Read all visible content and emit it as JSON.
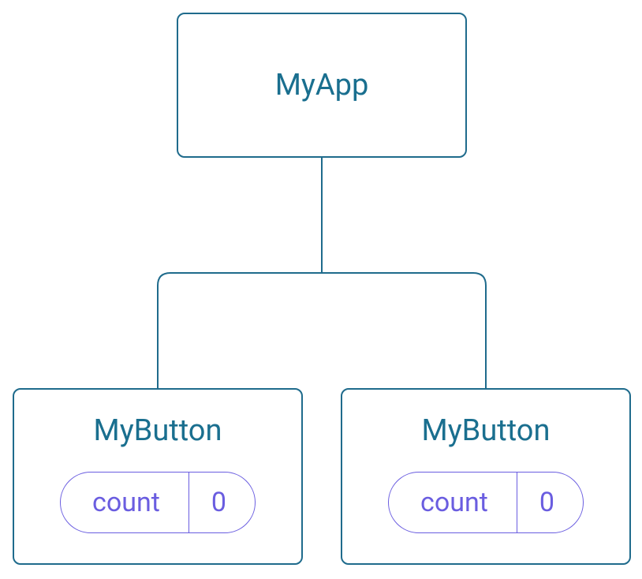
{
  "root": {
    "title": "MyApp"
  },
  "children": [
    {
      "title": "MyButton",
      "state": {
        "label": "count",
        "value": "0"
      }
    },
    {
      "title": "MyButton",
      "state": {
        "label": "count",
        "value": "0"
      }
    }
  ],
  "colors": {
    "nodeBorder": "#1f6b8c",
    "nodeText": "#1a6f8f",
    "pillBorder": "#6a5de0",
    "pillText": "#6a5de0",
    "connector": "#1f6b8c"
  }
}
